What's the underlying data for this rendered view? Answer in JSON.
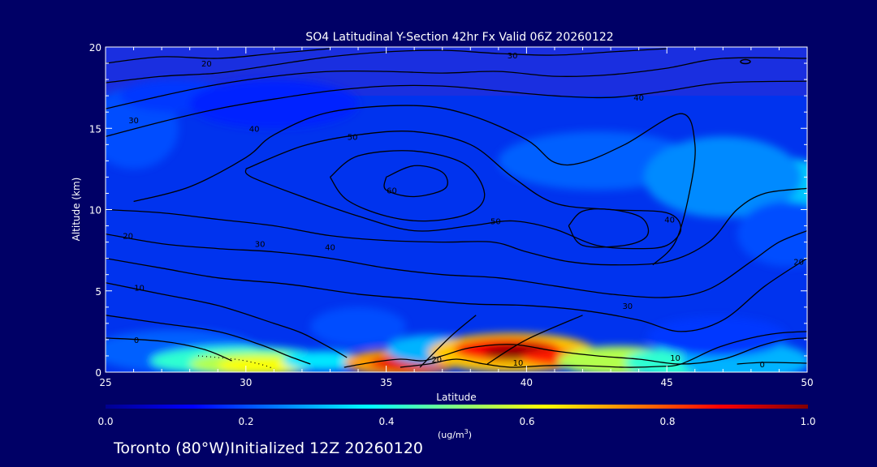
{
  "chart_data": {
    "type": "heatmap",
    "title": "SO4 Latitudinal Y-Section 42hr  Fx Valid 06Z 20260122",
    "xlabel": "Latitude",
    "ylabel": "Altitude (km)",
    "xlim": [
      25,
      50
    ],
    "ylim": [
      0,
      20
    ],
    "x_ticks": [
      25,
      30,
      35,
      40,
      45,
      50
    ],
    "y_ticks": [
      0,
      5,
      10,
      15,
      20
    ],
    "colorbar": {
      "min": 0.0,
      "max": 1.0,
      "ticks": [
        "0.0",
        "0.2",
        "0.4",
        "0.6",
        "0.8",
        "1.0"
      ],
      "unit_text": "(ug/m",
      "unit_sup": "3",
      "unit_close": ")",
      "colormap": [
        "#00008f",
        "#0000ff",
        "#0080ff",
        "#00ffff",
        "#80ff80",
        "#ffff00",
        "#ff8000",
        "#ff0000",
        "#800000"
      ]
    },
    "contour_labels": [
      {
        "x": 28.6,
        "y": 19.0,
        "text": "20"
      },
      {
        "x": 39.5,
        "y": 19.5,
        "text": "30"
      },
      {
        "x": 26.0,
        "y": 15.5,
        "text": "30"
      },
      {
        "x": 30.3,
        "y": 15.0,
        "text": "40"
      },
      {
        "x": 33.8,
        "y": 14.5,
        "text": "50"
      },
      {
        "x": 35.2,
        "y": 11.2,
        "text": "60"
      },
      {
        "x": 38.9,
        "y": 9.3,
        "text": "50"
      },
      {
        "x": 44.0,
        "y": 16.9,
        "text": "40"
      },
      {
        "x": 45.1,
        "y": 9.4,
        "text": "40"
      },
      {
        "x": 25.8,
        "y": 8.4,
        "text": "20"
      },
      {
        "x": 30.5,
        "y": 7.9,
        "text": "30"
      },
      {
        "x": 33.0,
        "y": 7.7,
        "text": "40"
      },
      {
        "x": 26.2,
        "y": 5.2,
        "text": "10"
      },
      {
        "x": 43.6,
        "y": 4.1,
        "text": "30"
      },
      {
        "x": 49.7,
        "y": 6.8,
        "text": "20"
      },
      {
        "x": 26.1,
        "y": 2.0,
        "text": "0"
      },
      {
        "x": 36.8,
        "y": 0.8,
        "text": "20"
      },
      {
        "x": 39.7,
        "y": 0.6,
        "text": "10"
      },
      {
        "x": 45.3,
        "y": 0.9,
        "text": "10"
      },
      {
        "x": 48.4,
        "y": 0.5,
        "text": "0"
      }
    ],
    "concentration_blobs": [
      {
        "x": 26.0,
        "y": 15.0,
        "rx": 1.6,
        "ry": 2.5,
        "v": 0.2
      },
      {
        "x": 27.5,
        "y": 17.0,
        "rx": 2.0,
        "ry": 1.0,
        "v": 0.18
      },
      {
        "x": 42.5,
        "y": 13.0,
        "rx": 3.5,
        "ry": 1.8,
        "v": 0.22
      },
      {
        "x": 48.5,
        "y": 11.5,
        "rx": 2.6,
        "ry": 1.8,
        "v": 0.32
      },
      {
        "x": 47.0,
        "y": 12.0,
        "rx": 2.8,
        "ry": 2.5,
        "v": 0.26
      },
      {
        "x": 49.3,
        "y": 8.5,
        "rx": 1.8,
        "ry": 2.0,
        "v": 0.2
      },
      {
        "x": 31.0,
        "y": 16.5,
        "rx": 3.0,
        "ry": 1.5,
        "v": 0.16
      },
      {
        "x": 34.0,
        "y": 2.8,
        "rx": 1.7,
        "ry": 1.2,
        "v": 0.2
      },
      {
        "x": 27.5,
        "y": 1.3,
        "rx": 3.0,
        "ry": 1.3,
        "v": 0.22
      },
      {
        "x": 29.8,
        "y": 0.7,
        "rx": 3.2,
        "ry": 0.9,
        "v": 0.42
      },
      {
        "x": 30.3,
        "y": 0.5,
        "rx": 2.3,
        "ry": 0.7,
        "v": 0.55
      },
      {
        "x": 30.5,
        "y": 0.4,
        "rx": 1.5,
        "ry": 0.5,
        "v": 0.62
      },
      {
        "x": 32.8,
        "y": 0.7,
        "rx": 1.5,
        "ry": 0.6,
        "v": 0.35
      },
      {
        "x": 35.5,
        "y": 0.6,
        "rx": 2.0,
        "ry": 0.8,
        "v": 0.72
      },
      {
        "x": 35.8,
        "y": 0.55,
        "rx": 1.4,
        "ry": 0.5,
        "v": 0.9
      },
      {
        "x": 36.6,
        "y": 1.4,
        "rx": 1.6,
        "ry": 0.9,
        "v": 0.3
      },
      {
        "x": 39.5,
        "y": 1.2,
        "rx": 3.0,
        "ry": 1.2,
        "v": 0.68
      },
      {
        "x": 39.3,
        "y": 1.4,
        "rx": 1.9,
        "ry": 0.7,
        "v": 0.88
      },
      {
        "x": 39.8,
        "y": 1.2,
        "rx": 1.3,
        "ry": 0.5,
        "v": 0.98
      },
      {
        "x": 41.2,
        "y": 0.9,
        "rx": 1.4,
        "ry": 0.5,
        "v": 0.85
      },
      {
        "x": 43.3,
        "y": 0.7,
        "rx": 2.2,
        "ry": 0.9,
        "v": 0.55
      },
      {
        "x": 45.3,
        "y": 0.6,
        "rx": 1.8,
        "ry": 0.9,
        "v": 0.42
      },
      {
        "x": 47.8,
        "y": 0.7,
        "rx": 2.3,
        "ry": 1.2,
        "v": 0.3
      },
      {
        "x": 46.8,
        "y": 2.2,
        "rx": 2.5,
        "ry": 1.2,
        "v": 0.18
      }
    ],
    "contours": [
      [
        [
          25,
          19.0
        ],
        [
          27,
          19.4
        ],
        [
          29,
          19.3
        ],
        [
          31,
          19.6
        ],
        [
          33,
          19.9
        ]
      ],
      [
        [
          25,
          17.8
        ],
        [
          27,
          18.2
        ],
        [
          29,
          18.4
        ],
        [
          31,
          18.9
        ],
        [
          33,
          19.4
        ],
        [
          35,
          19.7
        ],
        [
          37,
          19.8
        ],
        [
          39,
          19.6
        ],
        [
          41,
          19.5
        ],
        [
          43,
          19.7
        ],
        [
          45,
          19.9
        ]
      ],
      [
        [
          25,
          16.2
        ],
        [
          27,
          17.0
        ],
        [
          29,
          17.7
        ],
        [
          31,
          18.2
        ],
        [
          33,
          18.5
        ],
        [
          35,
          18.5
        ],
        [
          37,
          18.4
        ],
        [
          39,
          18.5
        ],
        [
          41,
          18.2
        ],
        [
          43,
          18.3
        ],
        [
          45,
          18.7
        ],
        [
          47,
          19.3
        ],
        [
          50,
          19.3
        ]
      ],
      [
        [
          25,
          14.5
        ],
        [
          27,
          15.4
        ],
        [
          29,
          16.2
        ],
        [
          31,
          16.8
        ],
        [
          33,
          17.3
        ],
        [
          35,
          17.6
        ],
        [
          37,
          17.6
        ],
        [
          39,
          17.3
        ],
        [
          41,
          17.0
        ],
        [
          43,
          16.9
        ],
        [
          45,
          17.3
        ],
        [
          47,
          17.8
        ],
        [
          50,
          17.9
        ]
      ],
      [
        [
          26,
          10.5
        ],
        [
          28,
          11.4
        ],
        [
          30,
          13.2
        ],
        [
          31,
          14.6
        ],
        [
          33,
          16.0
        ],
        [
          36,
          16.4
        ],
        [
          38,
          15.8
        ],
        [
          40,
          14.3
        ],
        [
          41,
          12.9
        ],
        [
          42,
          12.9
        ],
        [
          43.5,
          14.0
        ],
        [
          45.5,
          15.9
        ],
        [
          46,
          14.0
        ],
        [
          45.8,
          11.0
        ],
        [
          45.3,
          8.0
        ],
        [
          44.5,
          6.6
        ]
      ],
      [
        [
          30,
          12.5
        ],
        [
          32,
          13.9
        ],
        [
          34,
          14.6
        ],
        [
          36,
          14.8
        ],
        [
          38,
          14.0
        ],
        [
          39.5,
          12.0
        ],
        [
          41,
          10.4
        ],
        [
          43,
          10.0
        ],
        [
          45,
          9.8
        ],
        [
          45.5,
          8.8
        ],
        [
          45,
          7.8
        ],
        [
          44,
          7.6
        ],
        [
          42.5,
          7.8
        ],
        [
          41,
          8.8
        ],
        [
          39.5,
          9.3
        ],
        [
          38,
          9.0
        ],
        [
          36,
          8.7
        ],
        [
          34,
          9.6
        ],
        [
          32,
          10.8
        ],
        [
          30.2,
          12.0
        ],
        [
          30,
          12.5
        ]
      ],
      [
        [
          33,
          12.0
        ],
        [
          34,
          13.3
        ],
        [
          36,
          13.6
        ],
        [
          37.8,
          12.8
        ],
        [
          38.5,
          11.0
        ],
        [
          38.0,
          9.8
        ],
        [
          36.5,
          9.3
        ],
        [
          35,
          9.6
        ],
        [
          33.6,
          10.6
        ],
        [
          33,
          12.0
        ]
      ],
      [
        [
          35,
          12.0
        ],
        [
          36,
          12.7
        ],
        [
          37,
          12.3
        ],
        [
          37.1,
          11.3
        ],
        [
          36,
          10.8
        ],
        [
          35,
          11.2
        ],
        [
          35,
          12.0
        ]
      ],
      [
        [
          41.5,
          9.0
        ],
        [
          42,
          9.9
        ],
        [
          43,
          10.0
        ],
        [
          44.1,
          9.5
        ],
        [
          44.3,
          8.4
        ],
        [
          43.5,
          7.8
        ],
        [
          42,
          7.8
        ],
        [
          41.5,
          9.0
        ]
      ],
      [
        [
          25,
          10.0
        ],
        [
          27,
          9.8
        ],
        [
          29,
          9.4
        ],
        [
          31,
          9.0
        ],
        [
          33,
          8.4
        ],
        [
          35,
          8.1
        ],
        [
          37,
          8.0
        ],
        [
          38.8,
          8.0
        ],
        [
          40,
          7.4
        ],
        [
          41.5,
          6.8
        ],
        [
          43,
          6.6
        ],
        [
          45,
          6.8
        ],
        [
          46.5,
          8.0
        ],
        [
          47.5,
          10.0
        ],
        [
          48.5,
          11.0
        ],
        [
          50,
          11.3
        ]
      ],
      [
        [
          25,
          8.5
        ],
        [
          27,
          7.9
        ],
        [
          29,
          7.6
        ],
        [
          31,
          7.4
        ],
        [
          33,
          7.0
        ],
        [
          35,
          6.4
        ],
        [
          37,
          6.0
        ],
        [
          39,
          5.8
        ],
        [
          41,
          5.3
        ],
        [
          43,
          4.8
        ],
        [
          45,
          4.6
        ],
        [
          46.5,
          5.1
        ],
        [
          48,
          6.8
        ],
        [
          49,
          8.0
        ],
        [
          50,
          8.7
        ]
      ],
      [
        [
          25,
          7.0
        ],
        [
          27,
          6.4
        ],
        [
          29,
          5.8
        ],
        [
          31,
          5.5
        ],
        [
          32,
          5.3
        ],
        [
          34,
          4.8
        ],
        [
          36,
          4.5
        ],
        [
          38,
          4.2
        ],
        [
          40,
          4.1
        ],
        [
          42,
          3.8
        ],
        [
          44,
          3.2
        ],
        [
          45.5,
          2.5
        ],
        [
          47,
          3.2
        ],
        [
          48.5,
          5.3
        ],
        [
          50,
          7.0
        ]
      ],
      [
        [
          25,
          5.5
        ],
        [
          27,
          4.8
        ],
        [
          29,
          4.1
        ],
        [
          31,
          3.0
        ],
        [
          32,
          2.4
        ],
        [
          33,
          1.5
        ],
        [
          33.6,
          0.9
        ]
      ],
      [
        [
          25,
          3.5
        ],
        [
          27,
          3.0
        ],
        [
          29,
          2.5
        ],
        [
          30.5,
          1.7
        ],
        [
          31.5,
          1.0
        ],
        [
          32.3,
          0.5
        ]
      ],
      [
        [
          25,
          2.1
        ],
        [
          27,
          1.9
        ],
        [
          28.5,
          1.4
        ],
        [
          29.5,
          0.7
        ]
      ],
      [
        [
          33.5,
          0.3
        ],
        [
          34.5,
          0.6
        ],
        [
          35.5,
          0.8
        ],
        [
          36.3,
          0.7
        ],
        [
          37,
          1.0
        ],
        [
          38,
          1.5
        ],
        [
          39.5,
          1.7
        ],
        [
          41,
          1.3
        ],
        [
          42.5,
          1.0
        ],
        [
          44,
          0.8
        ],
        [
          45.5,
          0.5
        ],
        [
          47,
          0.8
        ],
        [
          48.3,
          1.6
        ],
        [
          49.2,
          2.0
        ],
        [
          50,
          2.1
        ]
      ],
      [
        [
          35.5,
          0.3
        ],
        [
          36.5,
          0.5
        ],
        [
          37.5,
          0.8
        ],
        [
          38.5,
          0.5
        ],
        [
          39.5,
          0.3
        ],
        [
          40.7,
          0.4
        ],
        [
          42,
          0.4
        ],
        [
          43.5,
          0.3
        ],
        [
          44.7,
          0.35
        ],
        [
          45.5,
          0.5
        ],
        [
          46.8,
          1.5
        ],
        [
          48,
          2.1
        ],
        [
          49,
          2.4
        ],
        [
          50,
          2.5
        ]
      ],
      [
        [
          36.2,
          0.3
        ],
        [
          37.3,
          2.2
        ],
        [
          38.2,
          3.5
        ]
      ],
      [
        [
          38.6,
          0.5
        ],
        [
          40,
          2.0
        ],
        [
          42,
          3.5
        ]
      ],
      [
        [
          47.5,
          0.5
        ],
        [
          48.5,
          0.6
        ],
        [
          50,
          0.55
        ]
      ]
    ],
    "dotted_contours": [
      [
        [
          28.3,
          1.0
        ],
        [
          29.0,
          0.9
        ],
        [
          29.8,
          0.75
        ],
        [
          30.6,
          0.45
        ],
        [
          31.0,
          0.2
        ]
      ]
    ],
    "small_marks": [
      {
        "x": 47.8,
        "y": 19.1
      }
    ]
  },
  "footer_text": "Toronto (80°W)Initialized 12Z 20260120"
}
